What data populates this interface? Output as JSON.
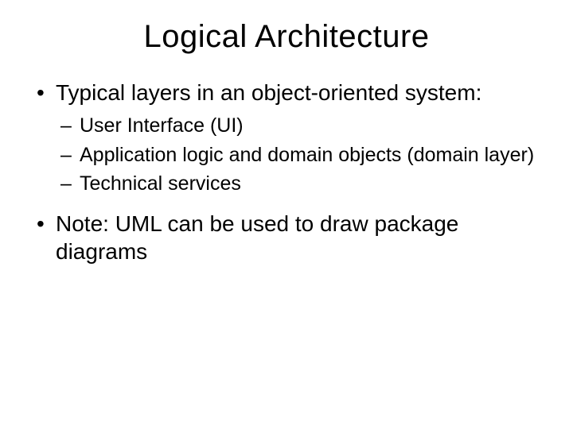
{
  "title": "Logical Architecture",
  "bullets": [
    {
      "text": "Typical layers in an object-oriented system:",
      "sub": [
        "User Interface (UI)",
        "Application logic and domain objects (domain layer)",
        "Technical services"
      ]
    },
    {
      "text": "Note: UML can be used to draw package diagrams",
      "sub": []
    }
  ]
}
